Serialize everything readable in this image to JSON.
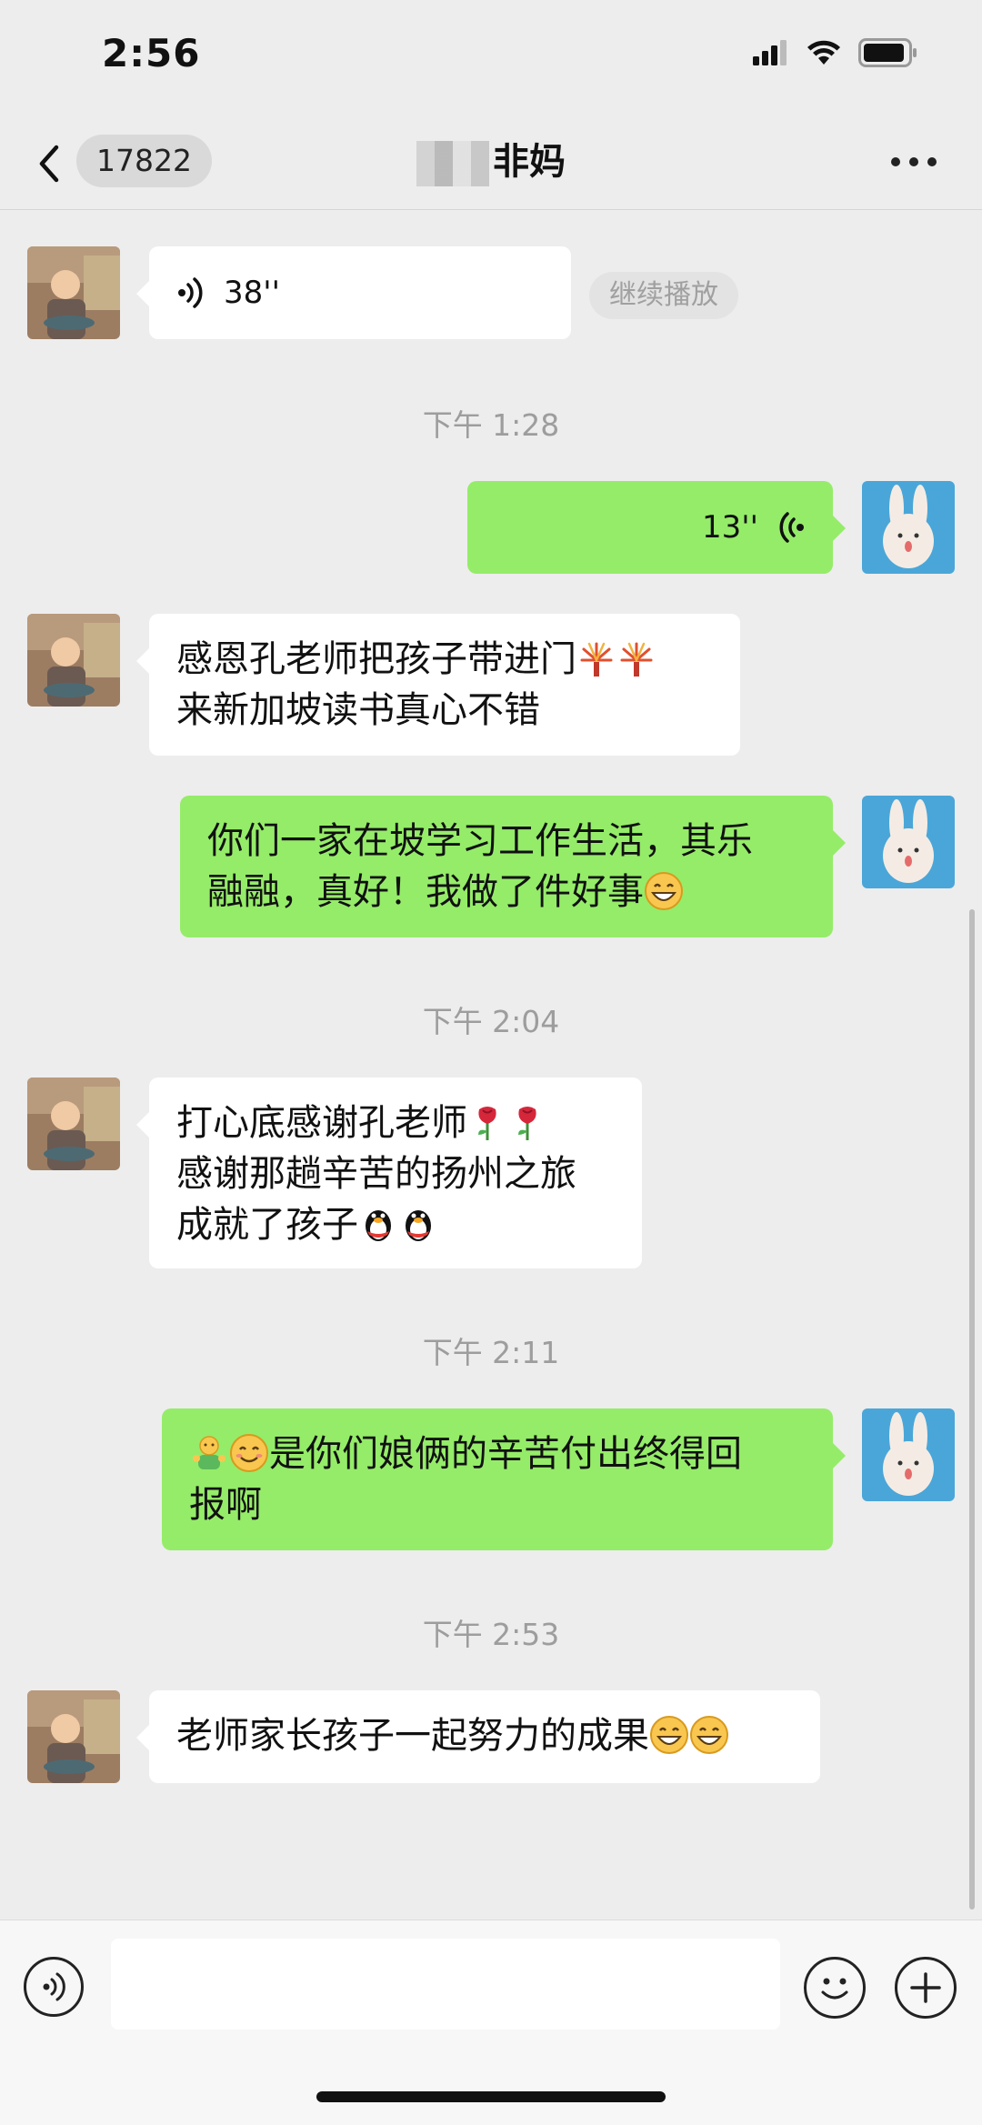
{
  "status_bar": {
    "time": "2:56",
    "icons": [
      "signal-icon",
      "wifi-icon",
      "battery-icon"
    ]
  },
  "header": {
    "back_icon": "chevron-left-icon",
    "unread_count": "17822",
    "title": "非妈",
    "more_icon": "more-dots-icon"
  },
  "messages": [
    {
      "side": "in",
      "type": "voice",
      "duration": "38''",
      "action": "继续播放"
    },
    {
      "type": "timestamp",
      "text": "下午 1:28"
    },
    {
      "side": "out",
      "type": "voice",
      "duration": "13''"
    },
    {
      "side": "in",
      "type": "text",
      "lines": [
        "感恩孔老师把孩子带进门",
        "来新加坡读书真心不错"
      ]
    },
    {
      "side": "out",
      "type": "text",
      "lines": [
        "你们一家在坡学习工作生活，其乐",
        "融融，真好！我做了件好事"
      ]
    },
    {
      "type": "timestamp",
      "text": "下午 2:04"
    },
    {
      "side": "in",
      "type": "text",
      "lines": [
        "打心底感谢孔老师",
        "感谢那趟辛苦的扬州之旅",
        "成就了孩子"
      ]
    },
    {
      "type": "timestamp",
      "text": "下午 2:11"
    },
    {
      "side": "out",
      "type": "text",
      "lines": [
        "是你们娘俩的辛苦付出终得回",
        "报啊"
      ]
    },
    {
      "type": "timestamp",
      "text": "下午 2:53"
    },
    {
      "side": "in",
      "type": "text",
      "lines": [
        "老师家长孩子一起努力的成果"
      ]
    }
  ],
  "input_bar": {
    "voice_icon": "voice-input-icon",
    "text_value": "",
    "emoji_icon": "emoji-icon",
    "plus_icon": "plus-icon"
  },
  "colors": {
    "background": "#ededed",
    "outgoing_bubble": "#95ec69",
    "incoming_bubble": "#ffffff",
    "timestamp": "#9d9d9d"
  }
}
